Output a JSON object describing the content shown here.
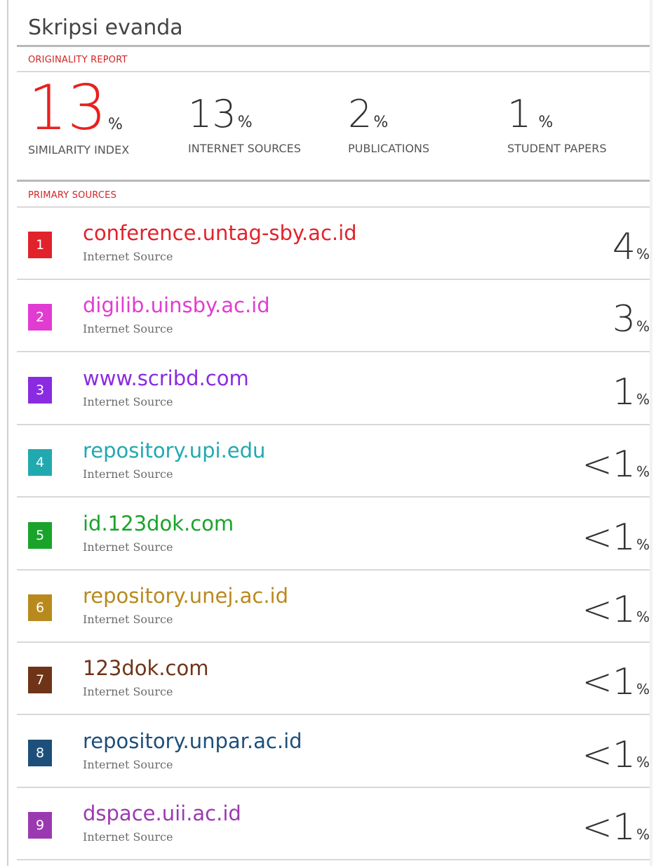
{
  "title": "Skripsi evanda",
  "originality_label": "ORIGINALITY REPORT",
  "stats": [
    {
      "value": "13",
      "unit": "%",
      "label": "SIMILARITY INDEX",
      "color": "#e8201f"
    },
    {
      "value": "13",
      "unit": "%",
      "label": "INTERNET SOURCES",
      "color": "#333333"
    },
    {
      "value": "2",
      "unit": "%",
      "label": "PUBLICATIONS",
      "color": "#333333"
    },
    {
      "value": "1",
      "unit": "%",
      "label": "STUDENT PAPERS",
      "color": "#333333"
    }
  ],
  "primary_label": "PRIMARY SOURCES",
  "sources": [
    {
      "rank": "1",
      "name": "conference.untag-sby.ac.id",
      "type": "Internet Source",
      "percent": "4",
      "unit": "%",
      "color": "#e2222b"
    },
    {
      "rank": "2",
      "name": "digilib.uinsby.ac.id",
      "type": "Internet Source",
      "percent": "3",
      "unit": "%",
      "color": "#e23bd2"
    },
    {
      "rank": "3",
      "name": "www.scribd.com",
      "type": "Internet Source",
      "percent": "1",
      "unit": "%",
      "color": "#8a2be2"
    },
    {
      "rank": "4",
      "name": "repository.upi.edu",
      "type": "Internet Source",
      "percent": "<1",
      "unit": "%",
      "color": "#21a9b0"
    },
    {
      "rank": "5",
      "name": "id.123dok.com",
      "type": "Internet Source",
      "percent": "<1",
      "unit": "%",
      "color": "#1aa32b"
    },
    {
      "rank": "6",
      "name": "repository.unej.ac.id",
      "type": "Internet Source",
      "percent": "<1",
      "unit": "%",
      "color": "#b88a1e"
    },
    {
      "rank": "7",
      "name": "123dok.com",
      "type": "Internet Source",
      "percent": "<1",
      "unit": "%",
      "color": "#6f3417"
    },
    {
      "rank": "8",
      "name": "repository.unpar.ac.id",
      "type": "Internet Source",
      "percent": "<1",
      "unit": "%",
      "color": "#1d4f7a"
    },
    {
      "rank": "9",
      "name": "dspace.uii.ac.id",
      "type": "Internet Source",
      "percent": "<1",
      "unit": "%",
      "color": "#9b3ab0"
    }
  ]
}
